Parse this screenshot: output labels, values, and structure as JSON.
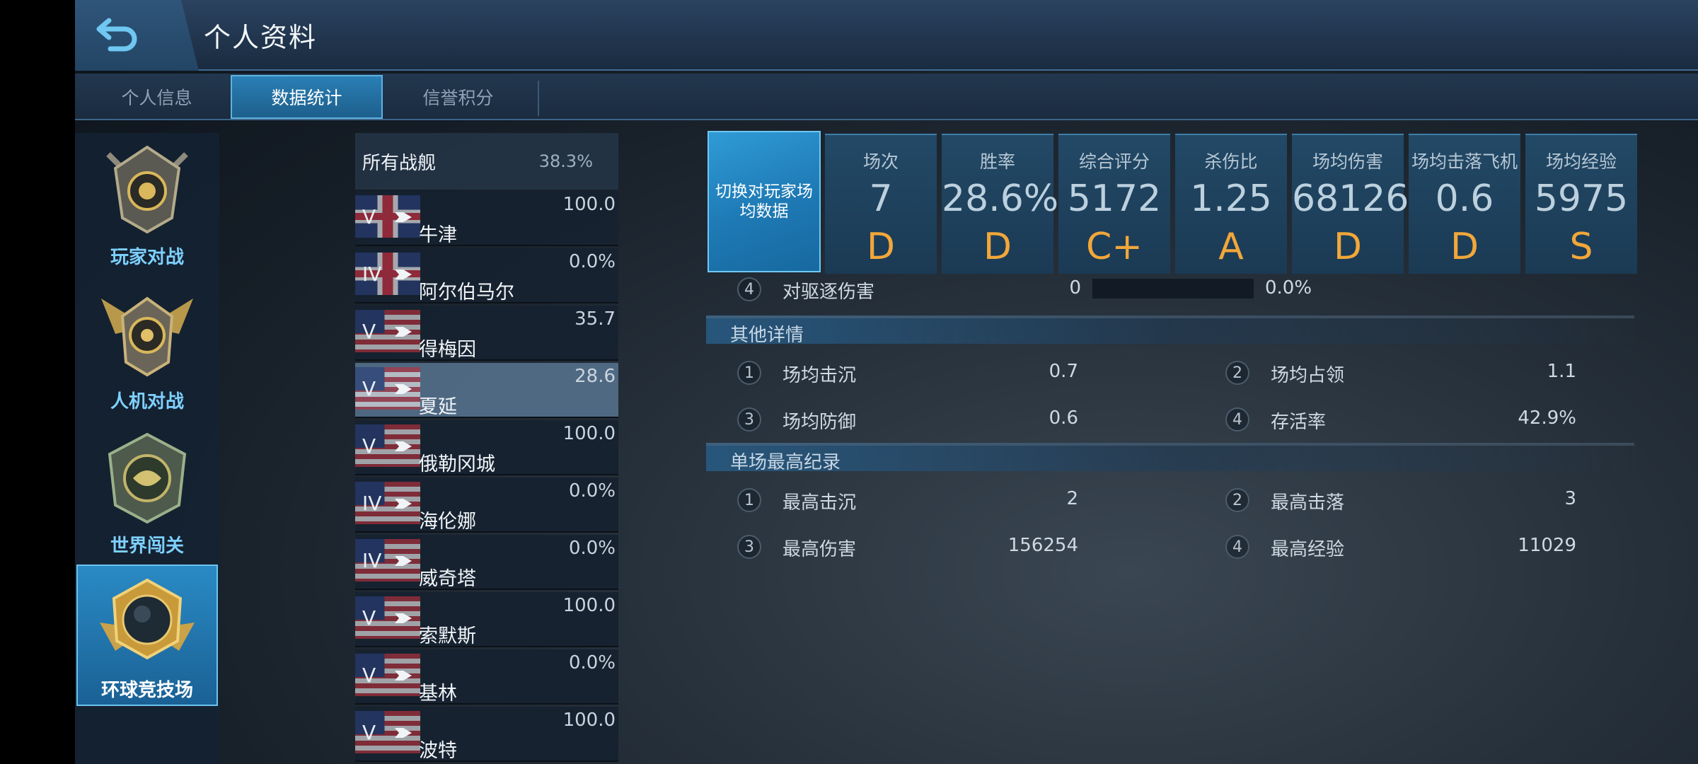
{
  "header": {
    "title": "个人资料"
  },
  "tabs": [
    {
      "label": "个人信息"
    },
    {
      "label": "数据统计"
    },
    {
      "label": "信誉积分"
    }
  ],
  "modes": [
    {
      "label": "玩家对战",
      "icon": "crossed-cannons-emblem-icon"
    },
    {
      "label": "人机对战",
      "icon": "winged-helm-emblem-icon"
    },
    {
      "label": "世界闯关",
      "icon": "globe-laurel-emblem-icon"
    },
    {
      "label": "环球竞技场",
      "icon": "globe-wings-emblem-icon",
      "active": true
    }
  ],
  "ships": {
    "all": {
      "name": "所有战舰",
      "rate": "38.3%"
    },
    "items": [
      {
        "tier": "V",
        "name": "牛津",
        "rate": "100.0",
        "flag": "uk"
      },
      {
        "tier": "IV",
        "name": "阿尔伯马尔",
        "rate": "0.0%",
        "flag": "uk"
      },
      {
        "tier": "V",
        "name": "得梅因",
        "rate": "35.7",
        "flag": "us"
      },
      {
        "tier": "V",
        "name": "夏延",
        "rate": "28.6",
        "flag": "us",
        "selected": true
      },
      {
        "tier": "V",
        "name": "俄勒冈城",
        "rate": "100.0",
        "flag": "us"
      },
      {
        "tier": "IV",
        "name": "海伦娜",
        "rate": "0.0%",
        "flag": "us"
      },
      {
        "tier": "IV",
        "name": "威奇塔",
        "rate": "0.0%",
        "flag": "us"
      },
      {
        "tier": "V",
        "name": "索默斯",
        "rate": "100.0",
        "flag": "us"
      },
      {
        "tier": "V",
        "name": "基林",
        "rate": "0.0%",
        "flag": "us"
      },
      {
        "tier": "V",
        "name": "波特",
        "rate": "100.0",
        "flag": "us"
      }
    ]
  },
  "switch_button": "切换对玩家场均数据",
  "stats": [
    {
      "label": "场次",
      "value": "7",
      "grade": "D"
    },
    {
      "label": "胜率",
      "value": "28.6%",
      "grade": "D"
    },
    {
      "label": "综合评分",
      "value": "5172",
      "grade": "C+"
    },
    {
      "label": "杀伤比",
      "value": "1.25",
      "grade": "A"
    },
    {
      "label": "场均伤害",
      "value": "68126",
      "grade": "D"
    },
    {
      "label": "场均击落飞机",
      "value": "0.6",
      "grade": "D"
    },
    {
      "label": "场均经验",
      "value": "5975",
      "grade": "S"
    }
  ],
  "damage_row": {
    "num": "4",
    "label": "对驱逐伤害",
    "value": "0",
    "percent": "0.0%",
    "fill": 0
  },
  "other_details": {
    "title": "其他详情",
    "items": [
      {
        "num": "1",
        "label": "场均击沉",
        "value": "0.7"
      },
      {
        "num": "2",
        "label": "场均占领",
        "value": "1.1"
      },
      {
        "num": "3",
        "label": "场均防御",
        "value": "0.6"
      },
      {
        "num": "4",
        "label": "存活率",
        "value": "42.9%"
      }
    ]
  },
  "records": {
    "title": "单场最高纪录",
    "items": [
      {
        "num": "1",
        "label": "最高击沉",
        "value": "2"
      },
      {
        "num": "2",
        "label": "最高击落",
        "value": "3"
      },
      {
        "num": "3",
        "label": "最高伤害",
        "value": "156254"
      },
      {
        "num": "4",
        "label": "最高经验",
        "value": "11029"
      }
    ]
  },
  "colors": {
    "accent": "#2a8ac4",
    "grade": "#f2a73a",
    "mode_label": "#7ed0ff"
  }
}
